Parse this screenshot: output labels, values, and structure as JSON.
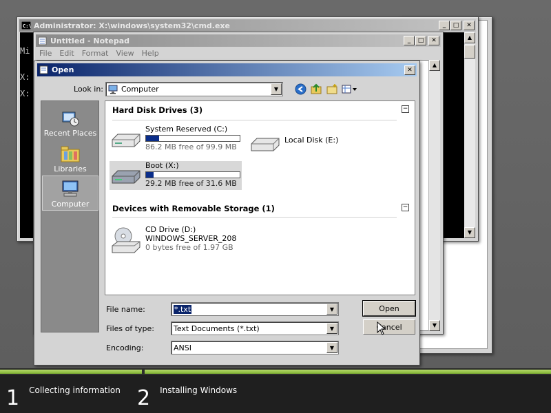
{
  "cmd": {
    "title": "Administrator: X:\\windows\\system32\\cmd.exe",
    "lines": [
      "Mi",
      "X:",
      "X:"
    ]
  },
  "notepad": {
    "title": "Untitled - Notepad",
    "menu": [
      "File",
      "Edit",
      "Format",
      "View",
      "Help"
    ]
  },
  "open_dialog": {
    "title": "Open",
    "look_in_label": "Look in:",
    "look_in_value": "Computer",
    "places": [
      {
        "label": "Recent Places",
        "icon": "recent-places-icon",
        "selected": false
      },
      {
        "label": "Libraries",
        "icon": "libraries-icon",
        "selected": false
      },
      {
        "label": "Computer",
        "icon": "computer-icon",
        "selected": true
      }
    ],
    "groups": {
      "hdd_header": "Hard Disk Drives (3)",
      "removable_header": "Devices with Removable Storage (1)"
    },
    "drives": {
      "system_reserved": {
        "name": "System Reserved (C:)",
        "free": "86.2 MB free of 99.9 MB",
        "used_fraction": 0.14
      },
      "local_disk": {
        "name": "Local Disk (E:)"
      },
      "boot": {
        "name": "Boot (X:)",
        "free": "29.2 MB free of 31.6 MB",
        "used_fraction": 0.08
      },
      "cd_drive": {
        "name": "CD Drive (D:)",
        "label": "WINDOWS_SERVER_208",
        "free": "0 bytes free of 1.97 GB"
      }
    },
    "file_name_label": "File name:",
    "file_name_value": "*.txt",
    "files_of_type_label": "Files of type:",
    "files_of_type_value": "Text Documents (*.txt)",
    "encoding_label": "Encoding:",
    "encoding_value": "ANSI",
    "open_button": "Open",
    "cancel_button": "Cancel"
  },
  "setup": {
    "steps": [
      {
        "num": "1",
        "label": "Collecting information"
      },
      {
        "num": "2",
        "label": "Installing Windows"
      }
    ]
  },
  "colors": {
    "progress_green": "#7fb232",
    "active_title": "#0a246a",
    "capacity_fill": "#0a2d8a"
  }
}
